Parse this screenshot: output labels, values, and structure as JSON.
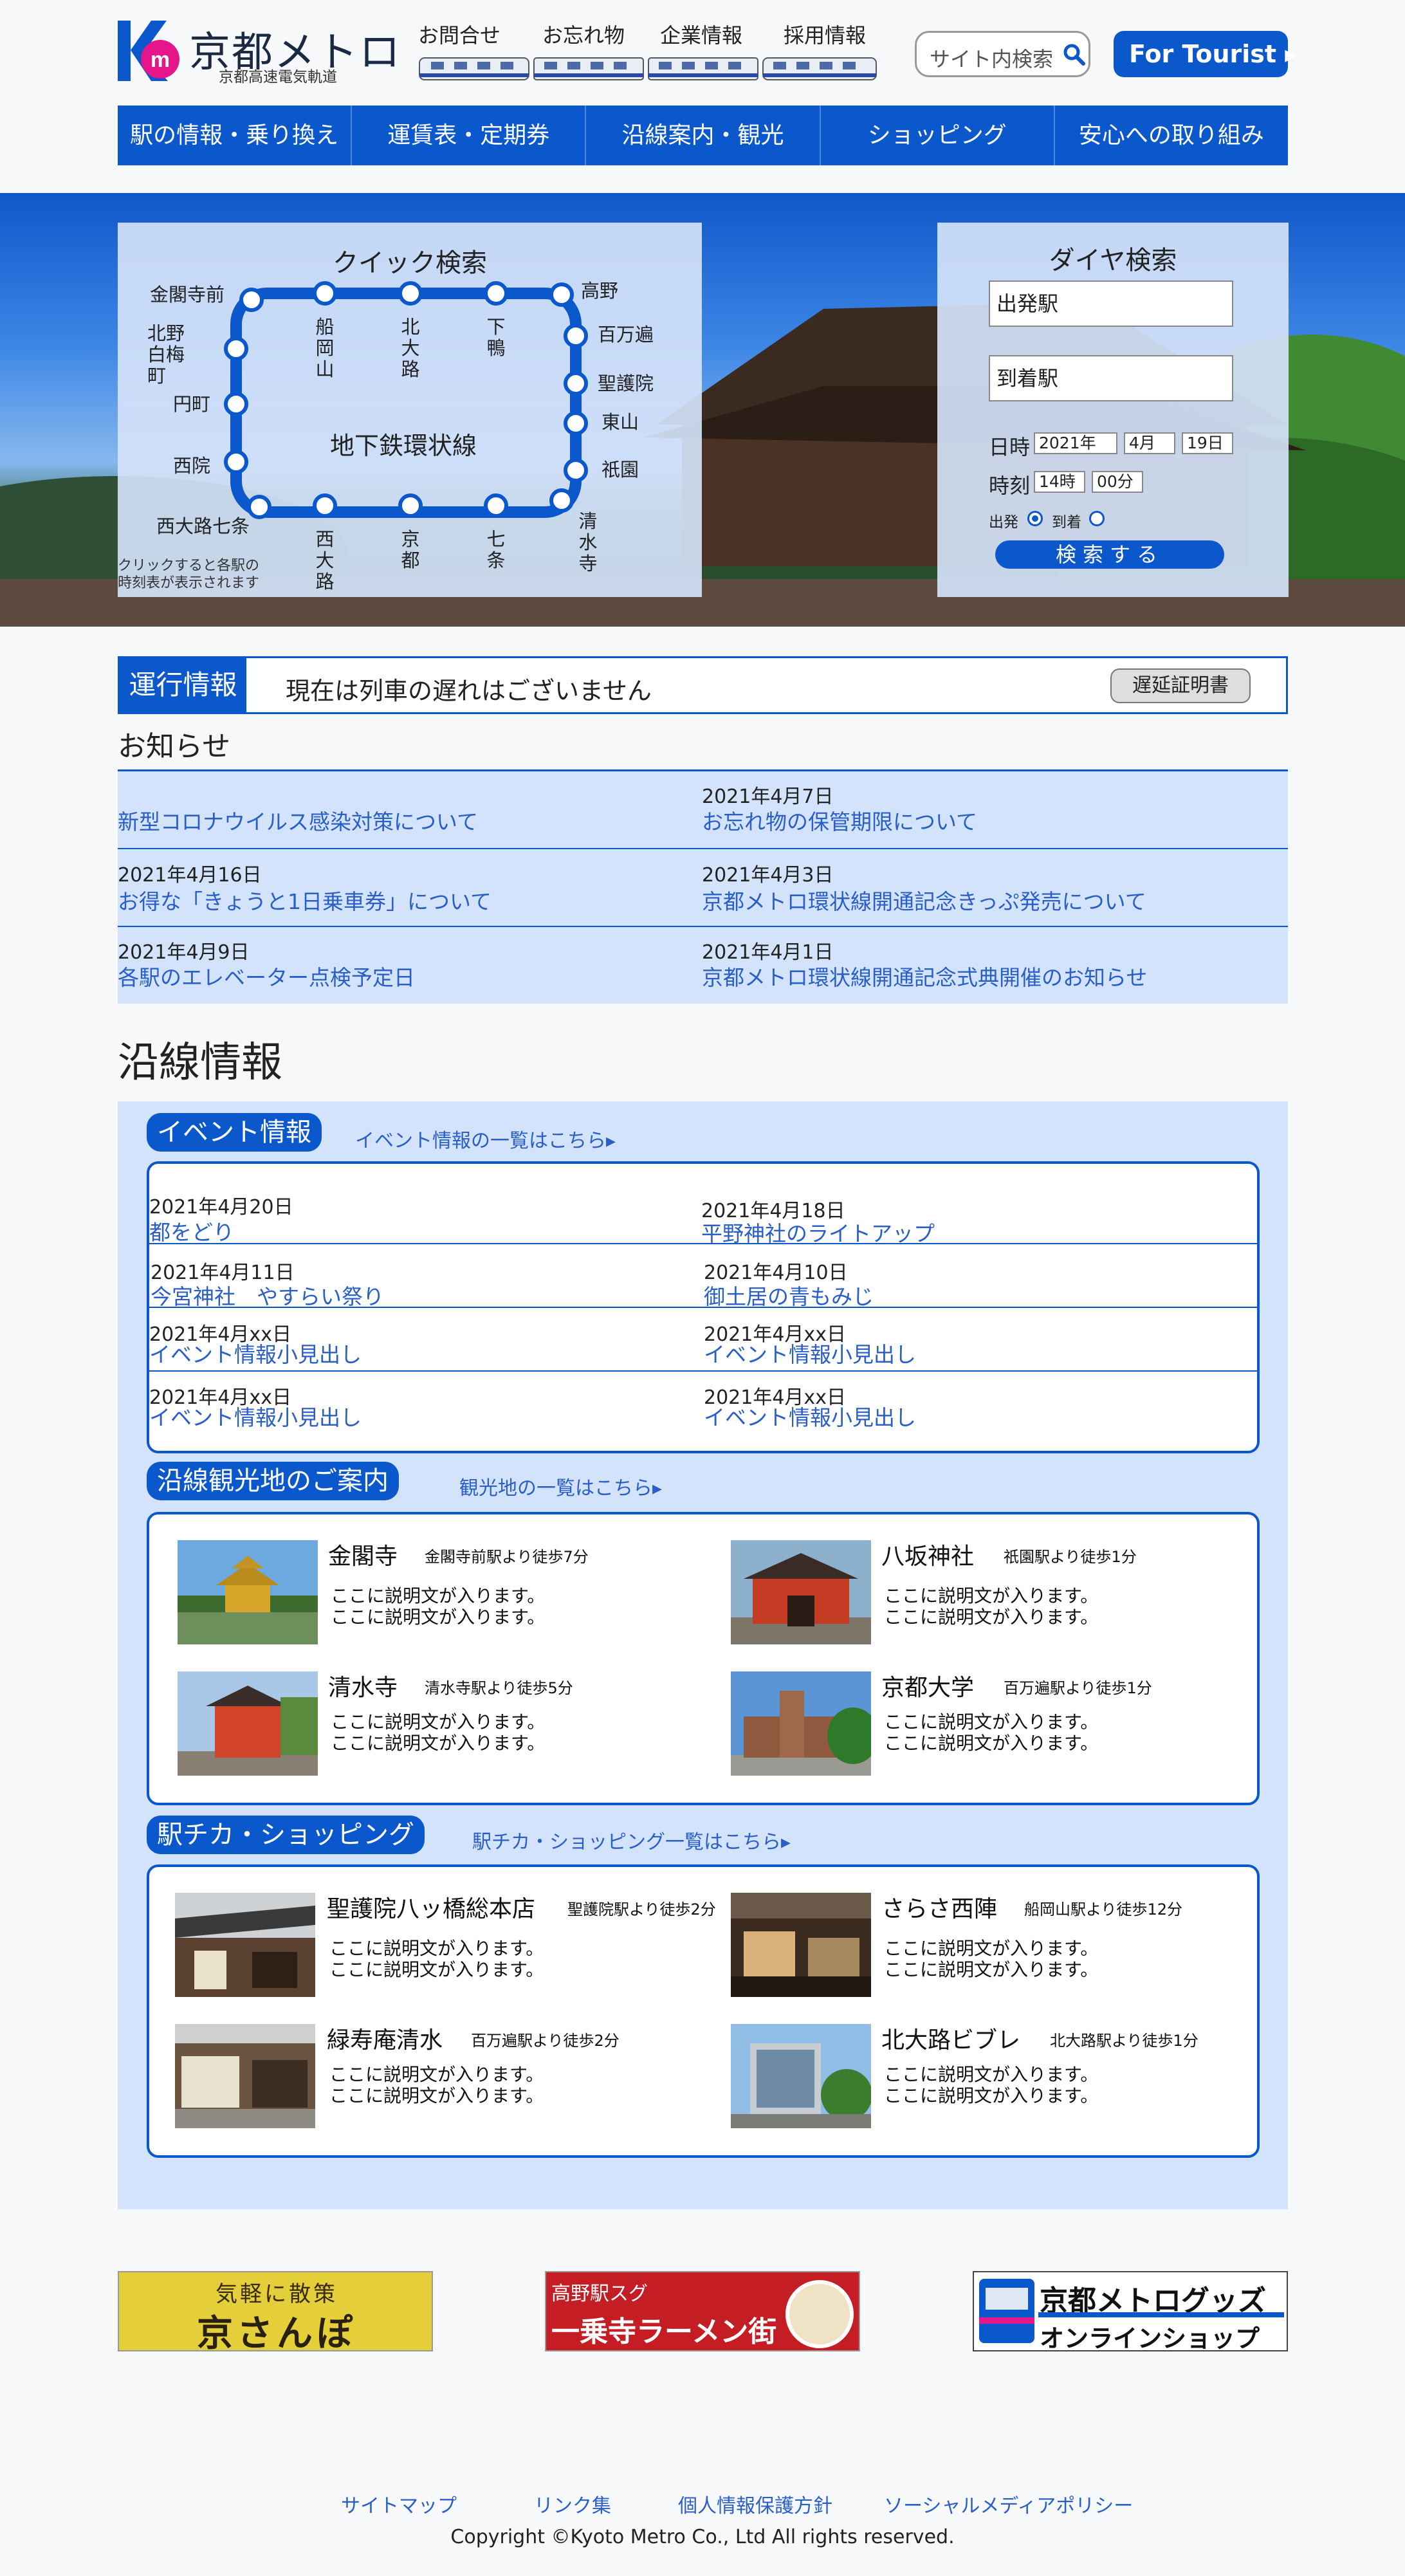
{
  "header": {
    "logo_text": "京都メトロ",
    "logo_sub": "京都高速電気軌道",
    "top_links": [
      "お問合せ",
      "お忘れ物",
      "企業情報",
      "採用情報"
    ],
    "search_placeholder": "サイト内検索",
    "tourist_button": "For Tourist ▸"
  },
  "nav": [
    "駅の情報・乗り換え",
    "運賃表・定期券",
    "沿線案内・観光",
    "ショッピング",
    "安心への取り組み"
  ],
  "quick_search": {
    "title": "クイック検索",
    "line_name": "地下鉄環状線",
    "note": "クリックすると各駅の\n時刻表が表示されます",
    "stations": [
      "金閣寺前",
      "船岡山",
      "北大路",
      "下鴨",
      "高野",
      "北野白梅町",
      "百万遍",
      "円町",
      "聖護院",
      "東山",
      "西院",
      "祇園",
      "西大路七条",
      "西大路",
      "京都",
      "七条",
      "清水寺"
    ]
  },
  "dia_search": {
    "title": "ダイヤ検索",
    "from": "出発駅",
    "to": "到着駅",
    "date_label": "日時",
    "year": "2021年",
    "month": "4月",
    "day": "19日",
    "time_label": "時刻",
    "hour": "14時",
    "minute": "00分",
    "depart": "出発",
    "arrive": "到着",
    "button": "検索する"
  },
  "operation": {
    "label": "運行情報",
    "message": "現在は列車の遅れはございません",
    "button": "遅延証明書"
  },
  "news": {
    "title": "お知らせ",
    "items": [
      {
        "date": "",
        "title": "新型コロナウイルス感染対策について"
      },
      {
        "date": "2021年4月7日",
        "title": "お忘れ物の保管期限について"
      },
      {
        "date": "2021年4月16日",
        "title": "お得な「きょうと1日乗車券」について"
      },
      {
        "date": "2021年4月3日",
        "title": "京都メトロ環状線開通記念きっぷ発売について"
      },
      {
        "date": "2021年4月9日",
        "title": "各駅のエレベーター点検予定日"
      },
      {
        "date": "2021年4月1日",
        "title": "京都メトロ環状線開通記念式典開催のお知らせ"
      }
    ]
  },
  "line_info": {
    "title": "沿線情報",
    "events": {
      "label": "イベント情報",
      "more": "イベント情報の一覧はこちら▸",
      "items": [
        {
          "date": "2021年4月20日",
          "title": "都をどり"
        },
        {
          "date": "2021年4月18日",
          "title": "平野神社のライトアップ"
        },
        {
          "date": "2021年4月11日",
          "title": "今宮神社　やすらい祭り"
        },
        {
          "date": "2021年4月10日",
          "title": "御土居の青もみじ"
        },
        {
          "date": "2021年4月xx日",
          "title": "イベント情報小見出し"
        },
        {
          "date": "2021年4月xx日",
          "title": "イベント情報小見出し"
        },
        {
          "date": "2021年4月xx日",
          "title": "イベント情報小見出し"
        },
        {
          "date": "2021年4月xx日",
          "title": "イベント情報小見出し"
        }
      ]
    },
    "sightseeing": {
      "label": "沿線観光地のご案内",
      "more": "観光地の一覧はこちら▸",
      "items": [
        {
          "name": "金閣寺",
          "walk": "金閣寺前駅より徒歩7分",
          "desc1": "ここに説明文が入ります。",
          "desc2": "ここに説明文が入ります。"
        },
        {
          "name": "八坂神社",
          "walk": "祇園駅より徒歩1分",
          "desc1": "ここに説明文が入ります。",
          "desc2": "ここに説明文が入ります。"
        },
        {
          "name": "清水寺",
          "walk": "清水寺駅より徒歩5分",
          "desc1": "ここに説明文が入ります。",
          "desc2": "ここに説明文が入ります。"
        },
        {
          "name": "京都大学",
          "walk": "百万遍駅より徒歩1分",
          "desc1": "ここに説明文が入ります。",
          "desc2": "ここに説明文が入ります。"
        }
      ]
    },
    "shopping": {
      "label": "駅チカ・ショッピング",
      "more": "駅チカ・ショッピング一覧はこちら▸",
      "items": [
        {
          "name": "聖護院八ッ橋総本店",
          "walk": "聖護院駅より徒歩2分",
          "desc1": "ここに説明文が入ります。",
          "desc2": "ここに説明文が入ります。"
        },
        {
          "name": "さらさ西陣",
          "walk": "船岡山駅より徒歩12分",
          "desc1": "ここに説明文が入ります。",
          "desc2": "ここに説明文が入ります。"
        },
        {
          "name": "緑寿庵清水",
          "walk": "百万遍駅より徒歩2分",
          "desc1": "ここに説明文が入ります。",
          "desc2": "ここに説明文が入ります。"
        },
        {
          "name": "北大路ビブレ",
          "walk": "北大路駅より徒歩1分",
          "desc1": "ここに説明文が入ります。",
          "desc2": "ここに説明文が入ります。"
        }
      ]
    }
  },
  "banners": {
    "sanpo_small": "気軽に散策",
    "sanpo": "京さんぽ",
    "ramen_small": "高野駅スグ",
    "ramen": "一乗寺ラーメン街",
    "goods": "京都メトログッズ",
    "goods_sub": "オンラインショップ"
  },
  "footer": {
    "links": [
      "サイトマップ",
      "リンク集",
      "個人情報保護方針",
      "ソーシャルメディアポリシー"
    ],
    "copyright": "Copyright ©Kyoto Metro Co., Ltd All rights reserved."
  },
  "colors": {
    "brand": "#0b58cc",
    "panel": "#d3e3fb",
    "link": "#2a5fc8",
    "logo_pink": "#e5168a"
  }
}
